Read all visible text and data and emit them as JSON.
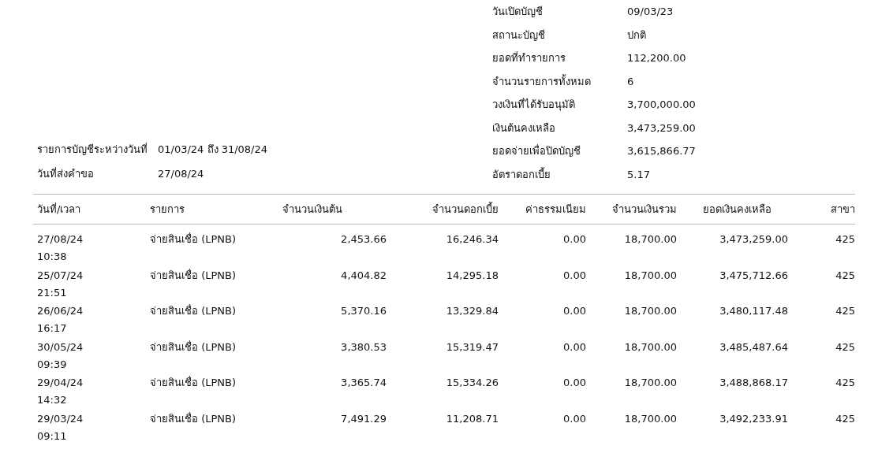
{
  "request_info": [
    {
      "label": "รายการบัญชีระหว่างวันที่",
      "value": "01/03/24 ถึง 31/08/24"
    },
    {
      "label": "วันที่ส่งคำขอ",
      "value": "27/08/24"
    }
  ],
  "account_info": [
    {
      "label": "วันเปิดบัญชี",
      "value": "09/03/23"
    },
    {
      "label": "สถานะบัญชี",
      "value": "ปกติ"
    },
    {
      "label": "ยอดที่ทำรายการ",
      "value": "112,200.00"
    },
    {
      "label": "จำนวนรายการทั้งหมด",
      "value": "6"
    },
    {
      "label": "วงเงินที่ได้รับอนุมัติ",
      "value": "3,700,000.00"
    },
    {
      "label": "เงินต้นคงเหลือ",
      "value": "3,473,259.00"
    },
    {
      "label": "ยอดจ่ายเพื่อปิดบัญชี",
      "value": "3,615,866.77"
    },
    {
      "label": "อัตราดอกเบี้ย",
      "value": "5.17"
    }
  ],
  "table": {
    "columns": [
      "วันที่/เวลา",
      "รายการ",
      "จำนวนเงินต้น",
      "จำนวนดอกเบี้ย",
      "ค่าธรรมเนียม",
      "จำนวนเงินรวม",
      "ยอดเงินคงเหลือ",
      "สาขา"
    ],
    "rows": [
      {
        "cells": [
          "27/08/24 10:38",
          "จ่ายสินเชื่อ (LPNB)",
          "2,453.66",
          "16,246.34",
          "0.00",
          "18,700.00",
          "3,473,259.00",
          "425"
        ]
      },
      {
        "cells": [
          "25/07/24 21:51",
          "จ่ายสินเชื่อ (LPNB)",
          "4,404.82",
          "14,295.18",
          "0.00",
          "18,700.00",
          "3,475,712.66",
          "425"
        ]
      },
      {
        "cells": [
          "26/06/24 16:17",
          "จ่ายสินเชื่อ (LPNB)",
          "5,370.16",
          "13,329.84",
          "0.00",
          "18,700.00",
          "3,480,117.48",
          "425"
        ]
      },
      {
        "cells": [
          "30/05/24 09:39",
          "จ่ายสินเชื่อ (LPNB)",
          "3,380.53",
          "15,319.47",
          "0.00",
          "18,700.00",
          "3,485,487.64",
          "425"
        ]
      },
      {
        "cells": [
          "29/04/24 14:32",
          "จ่ายสินเชื่อ (LPNB)",
          "3,365.74",
          "15,334.26",
          "0.00",
          "18,700.00",
          "3,488,868.17",
          "425"
        ]
      },
      {
        "cells": [
          "29/03/24 09:11",
          "จ่ายสินเชื่อ (LPNB)",
          "7,491.29",
          "11,208.71",
          "0.00",
          "18,700.00",
          "3,492,233.91",
          "425"
        ]
      }
    ]
  }
}
